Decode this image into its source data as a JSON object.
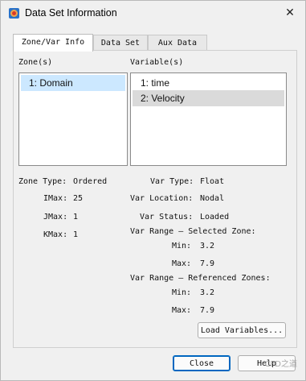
{
  "window": {
    "title": "Data Set Information"
  },
  "tabs": [
    {
      "label": "Zone/Var Info",
      "active": true
    },
    {
      "label": "Data Set",
      "active": false
    },
    {
      "label": "Aux Data",
      "active": false
    }
  ],
  "zones": {
    "header": "Zone(s)",
    "items": [
      "1: Domain"
    ],
    "selected_index": 0
  },
  "variables": {
    "header": "Variable(s)",
    "items": [
      "1: time",
      "2: Velocity"
    ],
    "selected_index": 1
  },
  "zone_info": {
    "zone_type_label": "Zone Type:",
    "zone_type_value": "Ordered",
    "imax_label": "IMax:",
    "imax_value": "25",
    "jmax_label": "JMax:",
    "jmax_value": "1",
    "kmax_label": "KMax:",
    "kmax_value": "1"
  },
  "var_info": {
    "var_type_label": "Var Type:",
    "var_type_value": "Float",
    "var_location_label": "Var Location:",
    "var_location_value": "Nodal",
    "var_status_label": "Var Status:",
    "var_status_value": "Loaded",
    "range_selected_label": "Var Range — Selected Zone:",
    "selected_min_label": "Min:",
    "selected_min_value": "3.2",
    "selected_max_label": "Max:",
    "selected_max_value": "7.9",
    "range_referenced_label": "Var Range — Referenced Zones:",
    "referenced_min_label": "Min:",
    "referenced_min_value": "3.2",
    "referenced_max_label": "Max:",
    "referenced_max_value": "7.9"
  },
  "buttons": {
    "load_variables": "Load Variables...",
    "close": "Close",
    "help": "Help"
  },
  "watermark": "CFD之道",
  "colors": {
    "selection_blue": "#cce8ff",
    "selection_gray": "#dadada",
    "primary_border": "#0067c0"
  }
}
